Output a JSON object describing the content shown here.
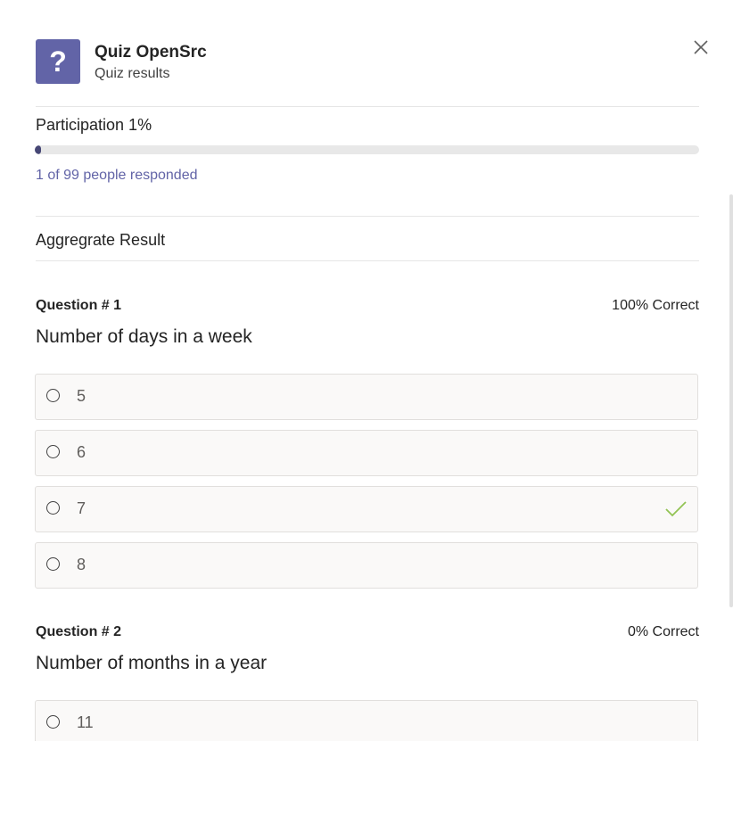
{
  "header": {
    "icon_glyph": "?",
    "title": "Quiz OpenSrc",
    "subtitle": "Quiz results",
    "close_icon": "close-icon"
  },
  "participation": {
    "label": "Participation 1%",
    "progress_fraction": 0.01,
    "responded_text": "1 of 99 people responded"
  },
  "aggregate": {
    "label": "Aggregrate Result"
  },
  "questions": [
    {
      "number": "Question # 1",
      "score": "100% Correct",
      "text": "Number of days in a week",
      "options": [
        {
          "label": "5",
          "correct": false
        },
        {
          "label": "6",
          "correct": false
        },
        {
          "label": "7",
          "correct": true
        },
        {
          "label": "8",
          "correct": false
        }
      ]
    },
    {
      "number": "Question # 2",
      "score": "0% Correct",
      "text": "Number of months in a year",
      "options": [
        {
          "label": "11",
          "correct": false
        }
      ]
    }
  ],
  "colors": {
    "accent": "#6264a7",
    "progress_fill": "#464775",
    "check": "#92c353"
  }
}
